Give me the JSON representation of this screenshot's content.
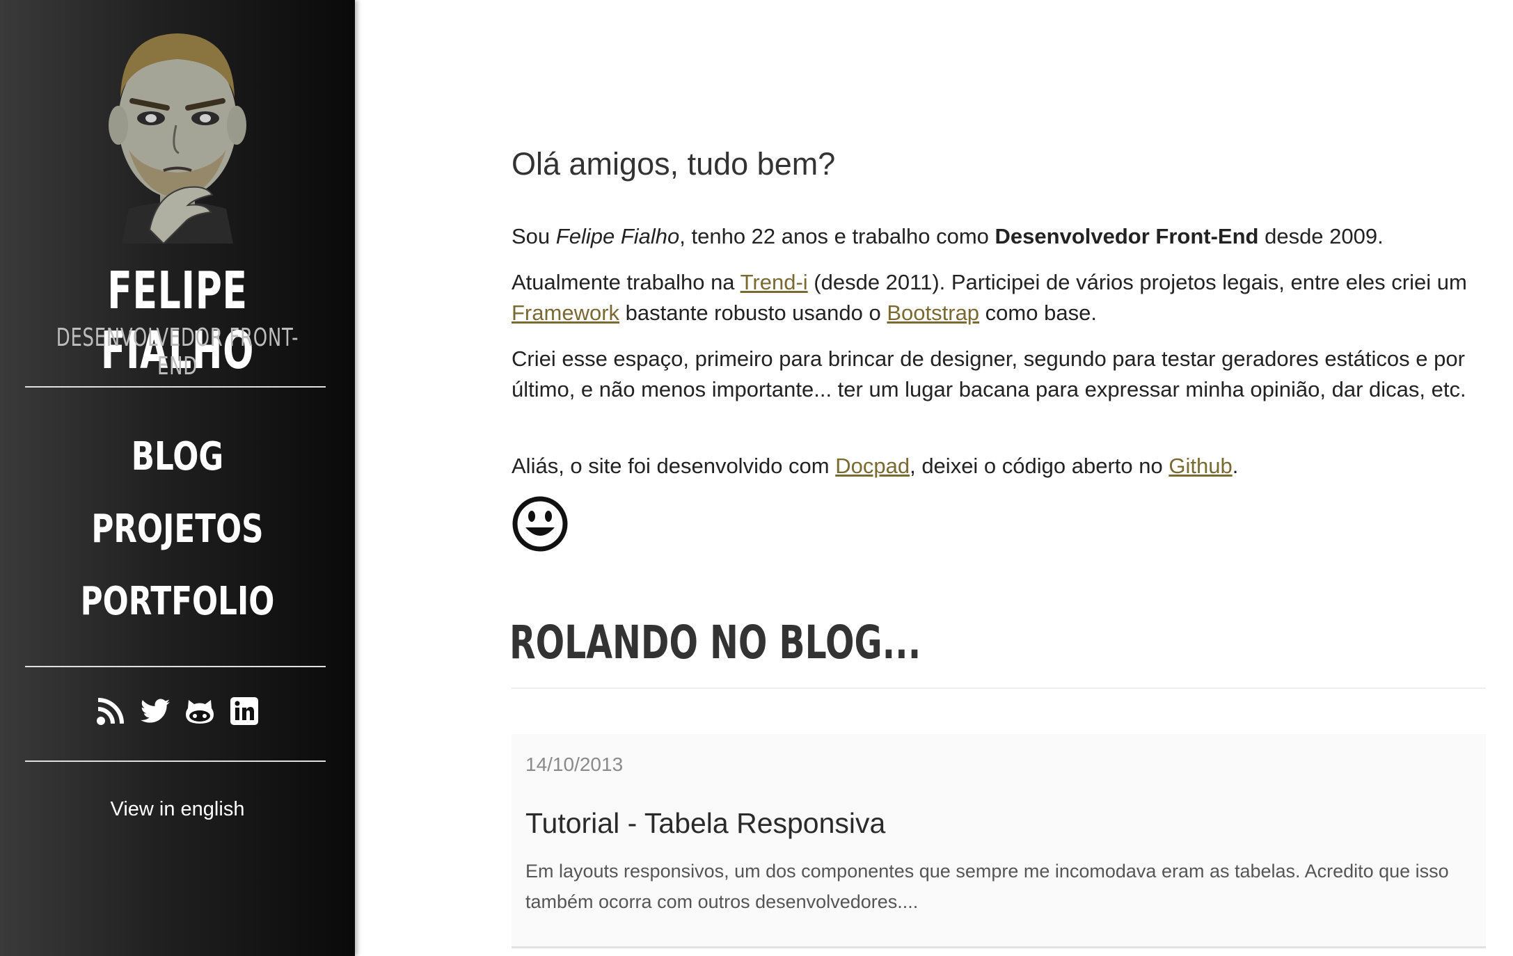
{
  "sidebar": {
    "title": "FELIPE FIALHO",
    "subtitle": "DESENVOLVEDOR FRONT-END",
    "nav": [
      {
        "label": "BLOG"
      },
      {
        "label": "PROJETOS"
      },
      {
        "label": "PORTFOLIO"
      }
    ],
    "social": [
      "rss-icon",
      "twitter-icon",
      "github-icon",
      "linkedin-icon"
    ],
    "language_link": "View in english"
  },
  "intro": {
    "greeting": "Olá amigos, tudo bem?",
    "p1": {
      "a": "Sou ",
      "name": "Felipe Fialho",
      "b": ", tenho 22 anos e trabalho como ",
      "role": "Desenvolvedor Front-End",
      "c": " desde 2009."
    },
    "p2": {
      "a": "Atualmente trabalho na ",
      "link1": "Trend-i",
      "b": " (desde 2011). Participei de vários projetos legais, entre eles criei um ",
      "link2": "Framework",
      "c": " bastante robusto usando o ",
      "link3": "Bootstrap",
      "d": " como base."
    },
    "p3": "Criei esse espaço, primeiro para brincar de designer, segundo para testar geradores estáticos e por último, e não menos importante... ter um lugar bacana para expressar minha opinião, dar dicas, etc.",
    "p4": {
      "a": "Aliás, o site foi desenvolvido com ",
      "link1": "Docpad",
      "b": ", deixei o código aberto no ",
      "link2": "Github",
      "c": "."
    }
  },
  "blog": {
    "heading": "ROLANDO NO BLOG...",
    "posts": [
      {
        "date": "14/10/2013",
        "title": "Tutorial - Tabela Responsiva",
        "excerpt": "Em layouts responsivos, um dos componentes que sempre me incomodava eram as tabelas. Acredito que isso também ocorra com outros desenvolvedores...."
      }
    ]
  },
  "colors": {
    "link": "#7a6a32",
    "sidebar_bg": "#1a1a1a"
  }
}
